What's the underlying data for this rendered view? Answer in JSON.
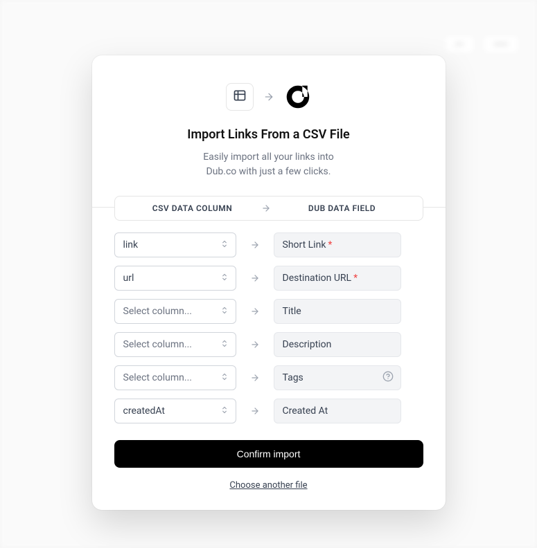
{
  "modal": {
    "title": "Import Links From a CSV File",
    "subtitle_line1": "Easily import all your links into",
    "subtitle_line2": "Dub.co with just a few clicks.",
    "column_header_left": "CSV DATA COLUMN",
    "column_header_right": "DUB DATA FIELD",
    "confirm_label": "Confirm import",
    "choose_another_label": "Choose another file"
  },
  "placeholders": {
    "select_column": "Select column..."
  },
  "mappings": [
    {
      "csv_value": "link",
      "has_value": true,
      "field_label": "Short Link",
      "required": true,
      "has_help": false
    },
    {
      "csv_value": "url",
      "has_value": true,
      "field_label": "Destination URL",
      "required": true,
      "has_help": false
    },
    {
      "csv_value": "",
      "has_value": false,
      "field_label": "Title",
      "required": false,
      "has_help": false
    },
    {
      "csv_value": "",
      "has_value": false,
      "field_label": "Description",
      "required": false,
      "has_help": false
    },
    {
      "csv_value": "",
      "has_value": false,
      "field_label": "Tags",
      "required": false,
      "has_help": true
    },
    {
      "csv_value": "createdAt",
      "has_value": true,
      "field_label": "Created At",
      "required": false,
      "has_help": false
    }
  ]
}
